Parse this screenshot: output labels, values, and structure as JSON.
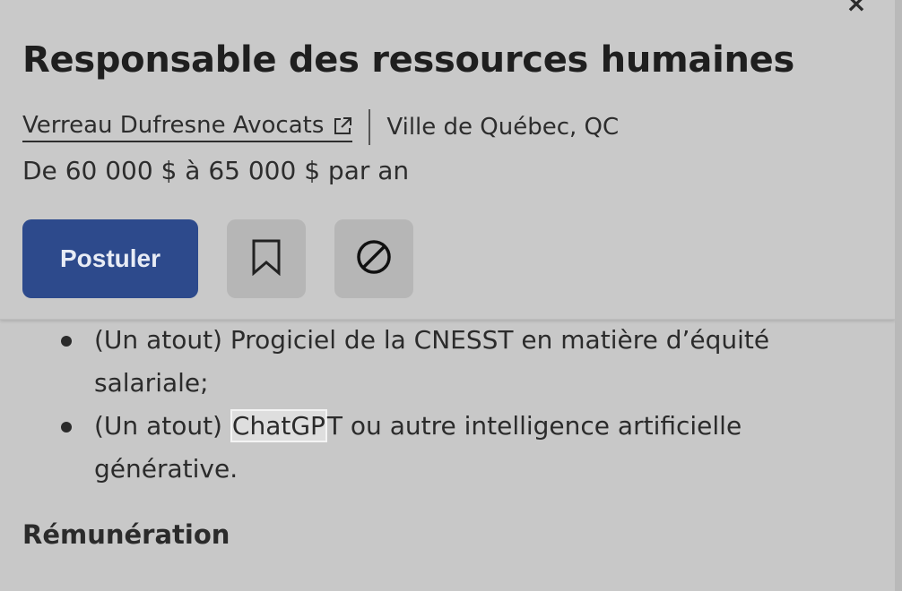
{
  "header": {
    "close_symbol": "×",
    "job_title": "Responsable des ressources humaines",
    "company": "Verreau Dufresne Avocats",
    "location": "Ville de Québec, QC",
    "salary": "De 60 000 $ à 65 000 $ par an",
    "apply_label": "Postuler"
  },
  "icons": {
    "external_link": "external-link-icon",
    "save": "bookmark-icon",
    "hide": "block-icon",
    "close": "close-icon"
  },
  "body": {
    "bullets": [
      {
        "prefix": "(Un atout) Progiciel de la CNESST en matière d’équité",
        "line2": "salariale;"
      },
      {
        "prefix": "(Un atout) ",
        "highlight": "ChatGP",
        "rest": "T ou autre intelligence artificielle",
        "line2": "générative."
      }
    ],
    "section_heading": "Rémunération"
  },
  "colors": {
    "apply_button": "#2d4a8c",
    "background": "#c8c8c8"
  }
}
